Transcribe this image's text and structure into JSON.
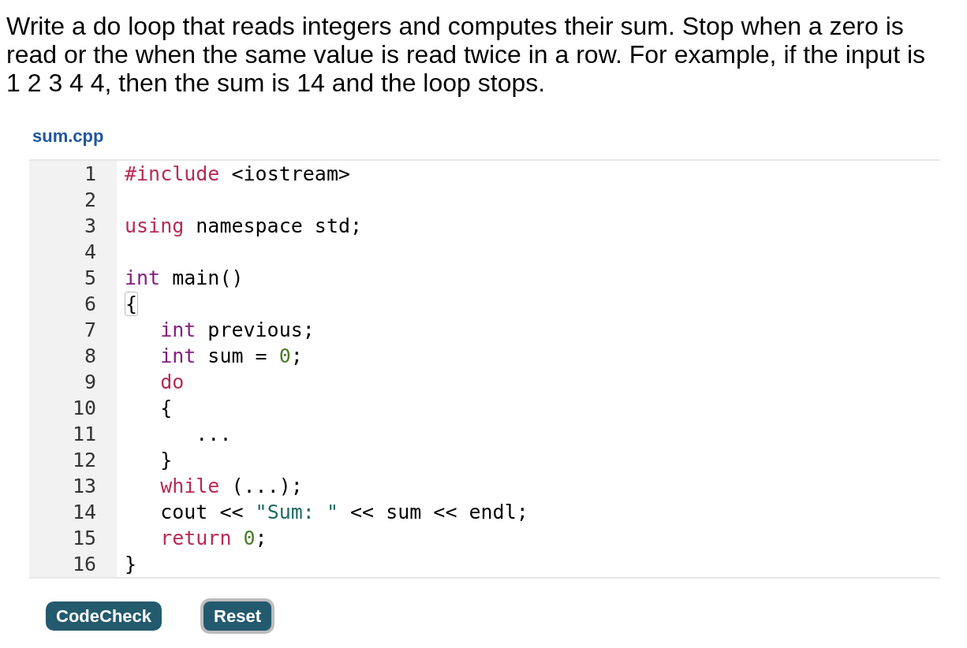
{
  "problem": {
    "text": "Write a do loop that reads integers and computes their sum. Stop when a zero is read or the when the same value is read twice in a row. For example, if the input is 1 2 3 4 4, then the sum is 14 and the loop stops."
  },
  "file": {
    "name": "sum.cpp"
  },
  "editor": {
    "lines": [
      {
        "number": "1",
        "tokens": [
          {
            "text": "#include",
            "kind": "keyword"
          },
          {
            "text": " <iostream>",
            "kind": "plain"
          }
        ]
      },
      {
        "number": "2"
      },
      {
        "number": "3",
        "tokens": [
          {
            "text": "using",
            "kind": "keyword"
          },
          {
            "text": " namespace std;",
            "kind": "plain"
          }
        ]
      },
      {
        "number": "4"
      },
      {
        "number": "5",
        "tokens": [
          {
            "text": "int",
            "kind": "type"
          },
          {
            "text": " main()",
            "kind": "plain"
          }
        ]
      },
      {
        "number": "6",
        "tokens": [
          {
            "text": "{",
            "kind": "matched-bracket"
          }
        ]
      },
      {
        "number": "7",
        "tokens": [
          {
            "text": "   int",
            "kind": "type"
          },
          {
            "text": " previous;",
            "kind": "plain"
          }
        ]
      },
      {
        "number": "8",
        "tokens": [
          {
            "text": "   int",
            "kind": "type"
          },
          {
            "text": " sum = ",
            "kind": "plain"
          },
          {
            "text": "0",
            "kind": "number"
          },
          {
            "text": ";",
            "kind": "plain"
          }
        ]
      },
      {
        "number": "9",
        "tokens": [
          {
            "text": "   do",
            "kind": "keyword"
          }
        ]
      },
      {
        "number": "10",
        "tokens": [
          {
            "text": "   {",
            "kind": "plain"
          }
        ]
      },
      {
        "number": "11",
        "tokens": [
          {
            "text": "      ...",
            "kind": "plain"
          }
        ]
      },
      {
        "number": "12",
        "tokens": [
          {
            "text": "   }",
            "kind": "plain"
          }
        ]
      },
      {
        "number": "13",
        "tokens": [
          {
            "text": "   while",
            "kind": "keyword"
          },
          {
            "text": " (...);",
            "kind": "plain"
          }
        ]
      },
      {
        "number": "14",
        "tokens": [
          {
            "text": "   cout << ",
            "kind": "plain"
          },
          {
            "text": "\"Sum: \"",
            "kind": "string"
          },
          {
            "text": " << sum << endl;",
            "kind": "plain"
          }
        ]
      },
      {
        "number": "15",
        "tokens": [
          {
            "text": "   return ",
            "kind": "keyword"
          },
          {
            "text": "0",
            "kind": "number"
          },
          {
            "text": ";",
            "kind": "plain"
          }
        ]
      },
      {
        "number": "16",
        "tokens": [
          {
            "text": "}",
            "kind": "plain"
          }
        ]
      }
    ]
  },
  "buttons": [
    {
      "label": "CodeCheck",
      "focused": false
    },
    {
      "label": "Reset",
      "focused": true
    }
  ]
}
